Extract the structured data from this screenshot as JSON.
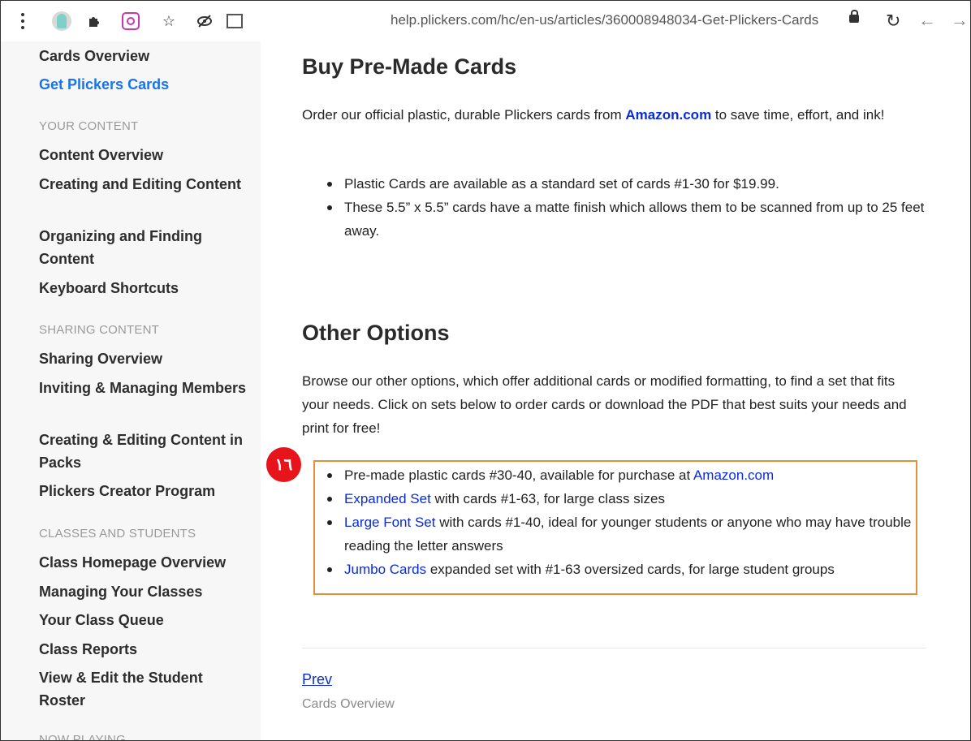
{
  "browser": {
    "url": "help.plickers.com/hc/en-us/articles/360008948034-Get-Plickers-Cards",
    "icons": [
      "kebab-menu-icon",
      "avatar-icon",
      "puzzle-icon",
      "instagram-icon",
      "star-icon",
      "eye-off-icon",
      "extension-icon",
      "lock-icon",
      "reload-icon",
      "back-arrow-icon",
      "forward-arrow-icon"
    ]
  },
  "sidebar": {
    "items_top": [
      "Cards Overview",
      "Get Plickers Cards"
    ],
    "section_content": "YOUR CONTENT",
    "content_items": [
      "Content Overview",
      "Creating and Editing Content",
      "Organizing and Finding Content",
      "Keyboard Shortcuts"
    ],
    "section_sharing": "SHARING CONTENT",
    "sharing_items": [
      "Sharing Overview",
      "Inviting & Managing Members",
      "Creating & Editing Content in Packs",
      "Plickers Creator Program"
    ],
    "section_classes": "CLASSES AND STUDENTS",
    "classes_items": [
      "Class Homepage Overview",
      "Managing Your Classes",
      "Your Class Queue",
      "Class Reports",
      "View & Edit the Student Roster"
    ],
    "section_now": "NOW PLAYING"
  },
  "main": {
    "buy_title": "Buy Pre-Made Cards",
    "buy_para_pre": "Order our official plastic, durable Plickers cards from ",
    "buy_para_link": "Amazon.com",
    "buy_para_post": " to save time, effort, and ink!",
    "buy_bullets": [
      "Plastic Cards are available as a standard set of cards #1-30 for $19.99.",
      "These 5.5” x 5.5” cards have a matte finish which allows them to be scanned from up to 25 feet away."
    ],
    "other_title": "Other Options",
    "other_para": "Browse our other options, which offer additional cards or modified formatting, to find a set that fits your needs. Click on sets below to order cards or download the PDF that best suits your needs and print for free!",
    "badge": "١٦",
    "options": [
      {
        "pre": "Pre-made plastic cards #30-40, available for purchase at ",
        "link": "Amazon.com",
        "post": ""
      },
      {
        "pre": "",
        "link": "Expanded Set",
        "post": " with cards #1-63, for large class sizes"
      },
      {
        "pre": "",
        "link": "Large Font Set",
        "post": " with cards #1-40, ideal for younger students or anyone who may have trouble reading the letter answers"
      },
      {
        "pre": "",
        "link": "Jumbo Cards",
        "post": " expanded set with #1-63 oversized cards, for large student groups"
      }
    ],
    "prev_label": "Prev",
    "prev_sub": "Cards Overview"
  }
}
